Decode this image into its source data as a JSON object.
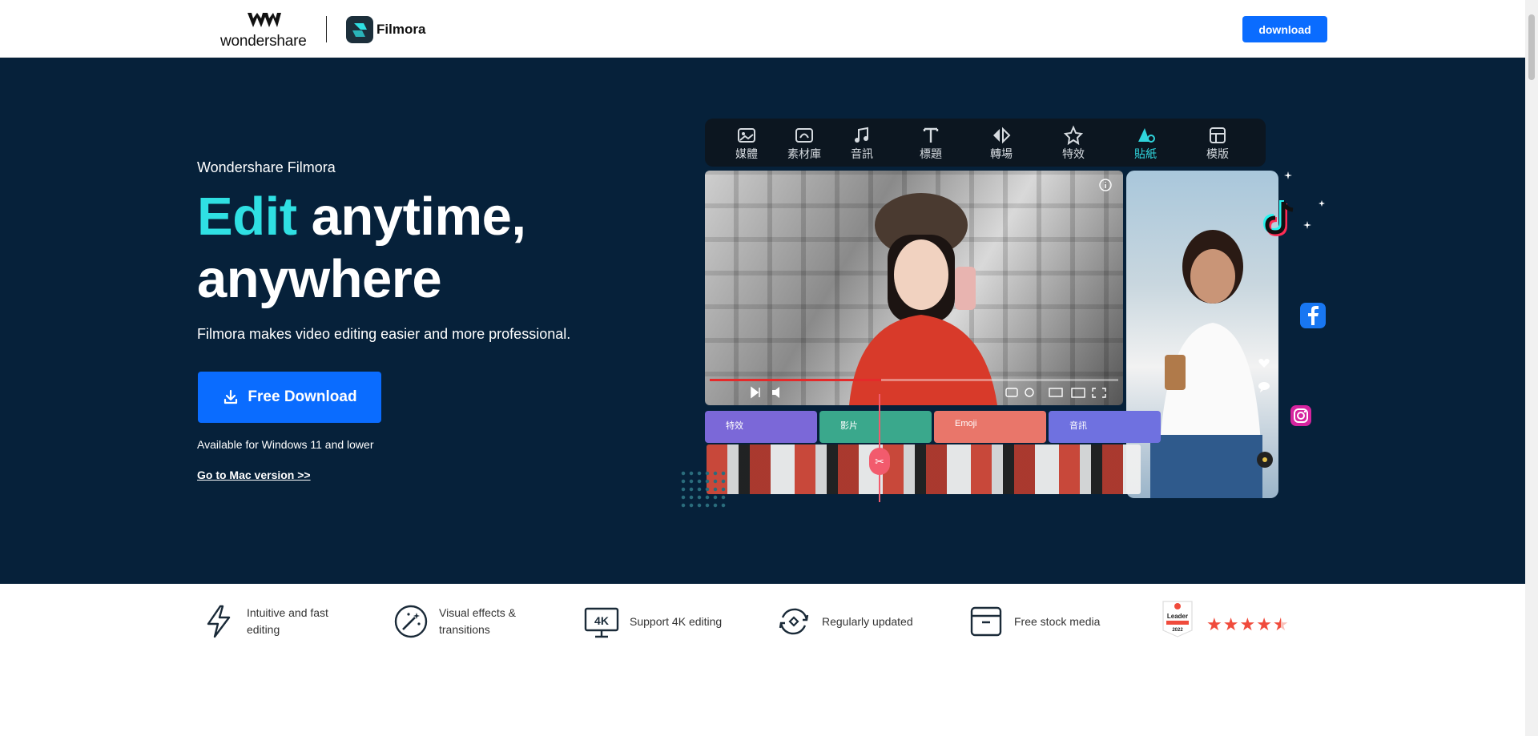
{
  "header": {
    "brand_text": "wondershare",
    "product_name": "Filmora",
    "download_label": "download"
  },
  "hero": {
    "eyebrow": "Wondershare Filmora",
    "headline_accent": "Edit",
    "headline_line1_rest": " anytime,",
    "headline_line2": "anywhere",
    "subhead": "Filmora makes video editing easier and more professional.",
    "cta_label": "Free Download",
    "availability": "Available for Windows 11 and lower",
    "mac_link": "Go to Mac version >>"
  },
  "editor": {
    "tools": [
      {
        "label": "媒體",
        "icon": "media-icon"
      },
      {
        "label": "素材庫",
        "icon": "stock-library-icon"
      },
      {
        "label": "音訊",
        "icon": "audio-icon"
      },
      {
        "label": "標題",
        "icon": "title-icon"
      },
      {
        "label": "轉場",
        "icon": "transition-icon"
      },
      {
        "label": "特效",
        "icon": "effects-icon"
      },
      {
        "label": "貼紙",
        "icon": "sticker-icon",
        "active": true
      },
      {
        "label": "模版",
        "icon": "template-icon"
      }
    ],
    "tracks": [
      {
        "label": "特效",
        "color": "#7b68d8"
      },
      {
        "label": "影片",
        "color": "#3aa88c"
      },
      {
        "label": "Emoji",
        "color": "#e9766a"
      },
      {
        "label": "音訊",
        "color": "#6f71e0"
      }
    ],
    "accent_color": "#2fe0e3",
    "cta_color": "#0a6cff",
    "hero_bg": "#06213a"
  },
  "features": [
    {
      "label": "Intuitive and fast editing",
      "icon": "lightning-icon"
    },
    {
      "label": "Visual effects & transitions",
      "icon": "magic-effects-icon"
    },
    {
      "label": "Support 4K editing",
      "icon": "4k-monitor-icon"
    },
    {
      "label": "Regularly updated",
      "icon": "update-cycle-icon"
    },
    {
      "label": "Free stock media",
      "icon": "stock-box-icon"
    }
  ],
  "rating": {
    "badge_text": "Leader",
    "badge_year": "2022",
    "stars": 4.5
  }
}
